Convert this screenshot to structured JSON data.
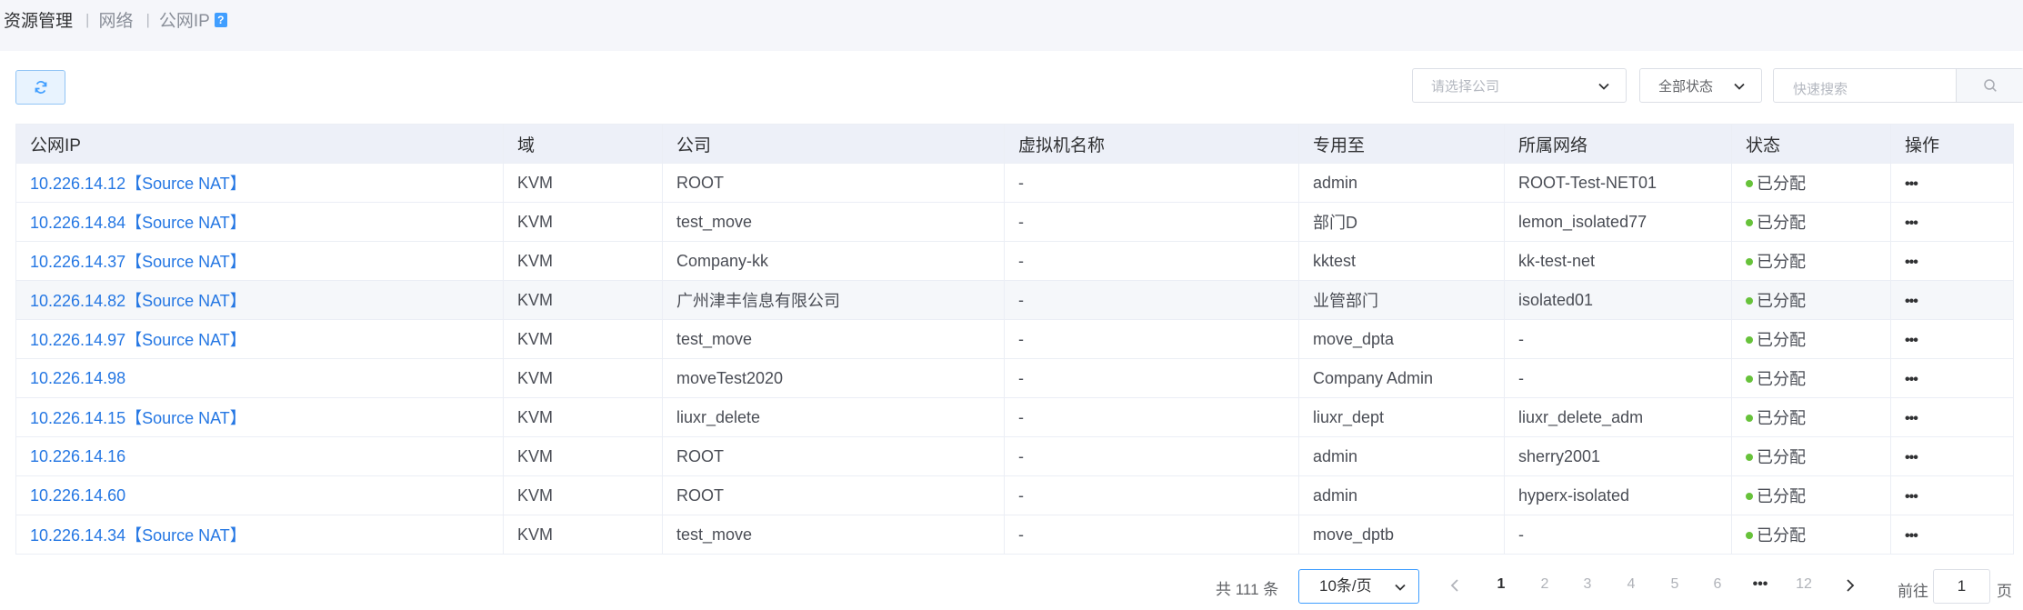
{
  "breadcrumb": {
    "root": "资源管理",
    "level1": "网络",
    "level2": "公网IP",
    "help": "?"
  },
  "toolbar": {
    "refresh_icon": "refresh-icon",
    "company_placeholder": "请选择公司",
    "status_value": "全部状态",
    "search_placeholder": "快速搜索",
    "search_icon": "search-icon"
  },
  "table": {
    "headers": [
      "公网IP",
      "域",
      "公司",
      "虚拟机名称",
      "专用至",
      "所属网络",
      "状态",
      "操作"
    ],
    "rows": [
      {
        "ip": "10.226.14.12【Source NAT】",
        "domain": "KVM",
        "company": "ROOT",
        "vm": "-",
        "dedicated": "admin",
        "network": "ROOT-Test-NET01",
        "status": "已分配",
        "action": "•••"
      },
      {
        "ip": "10.226.14.84【Source NAT】",
        "domain": "KVM",
        "company": "test_move",
        "vm": "-",
        "dedicated": "部门D",
        "network": "lemon_isolated77",
        "status": "已分配",
        "action": "•••"
      },
      {
        "ip": "10.226.14.37【Source NAT】",
        "domain": "KVM",
        "company": "Company-kk",
        "vm": "-",
        "dedicated": "kktest",
        "network": "kk-test-net",
        "status": "已分配",
        "action": "•••"
      },
      {
        "ip": "10.226.14.82【Source NAT】",
        "domain": "KVM",
        "company": "广州津丰信息有限公司",
        "vm": "-",
        "dedicated": "业管部门",
        "network": "isolated01",
        "status": "已分配",
        "action": "•••"
      },
      {
        "ip": "10.226.14.97【Source NAT】",
        "domain": "KVM",
        "company": "test_move",
        "vm": "-",
        "dedicated": "move_dpta",
        "network": "-",
        "status": "已分配",
        "action": "•••"
      },
      {
        "ip": "10.226.14.98",
        "domain": "KVM",
        "company": "moveTest2020",
        "vm": "-",
        "dedicated": "Company Admin",
        "network": "-",
        "status": "已分配",
        "action": "•••"
      },
      {
        "ip": "10.226.14.15【Source NAT】",
        "domain": "KVM",
        "company": "liuxr_delete",
        "vm": "-",
        "dedicated": "liuxr_dept",
        "network": "liuxr_delete_adm",
        "status": "已分配",
        "action": "•••"
      },
      {
        "ip": "10.226.14.16",
        "domain": "KVM",
        "company": "ROOT",
        "vm": "-",
        "dedicated": "admin",
        "network": "sherry2001",
        "status": "已分配",
        "action": "•••"
      },
      {
        "ip": "10.226.14.60",
        "domain": "KVM",
        "company": "ROOT",
        "vm": "-",
        "dedicated": "admin",
        "network": "hyperx-isolated",
        "status": "已分配",
        "action": "•••"
      },
      {
        "ip": "10.226.14.34【Source NAT】",
        "domain": "KVM",
        "company": "test_move",
        "vm": "-",
        "dedicated": "move_dptb",
        "network": "-",
        "status": "已分配",
        "action": "•••"
      }
    ]
  },
  "pagination": {
    "total": "共 111 条",
    "page_size": "10条/页",
    "pages": [
      "1",
      "2",
      "3",
      "4",
      "5",
      "6",
      "•••",
      "12"
    ],
    "current": "1",
    "goto_label": "前往",
    "goto_value": "1",
    "page_suffix": "页"
  },
  "colors": {
    "accent": "#409eff",
    "link": "#2577e3",
    "status_ok": "#67c23a"
  }
}
